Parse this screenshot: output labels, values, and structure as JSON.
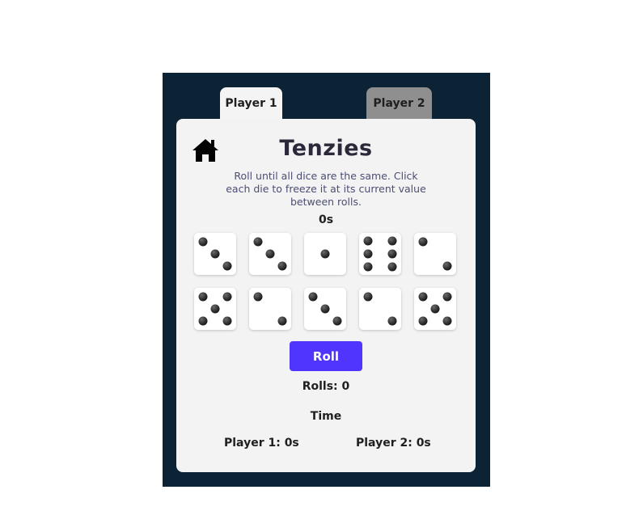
{
  "tabs": [
    {
      "label": "Player 1",
      "active": true
    },
    {
      "label": "Player 2",
      "active": false
    }
  ],
  "home_icon": "home-icon",
  "title": "Tenzies",
  "description": "Roll until all dice are the same. Click each die to freeze it at its current value between rolls.",
  "timer": "0s",
  "dice": [
    3,
    3,
    1,
    6,
    2,
    5,
    2,
    3,
    2,
    5
  ],
  "roll_button": "Roll",
  "rolls": "Rolls: 0",
  "time_label": "Time",
  "player_times": {
    "player1": "Player 1: 0s",
    "player2": "Player 2: 0s"
  },
  "colors": {
    "frame": "#0b2335",
    "card": "#f3f3f3",
    "accent": "#5035ff",
    "inactive_tab": "#8f8f8f"
  }
}
